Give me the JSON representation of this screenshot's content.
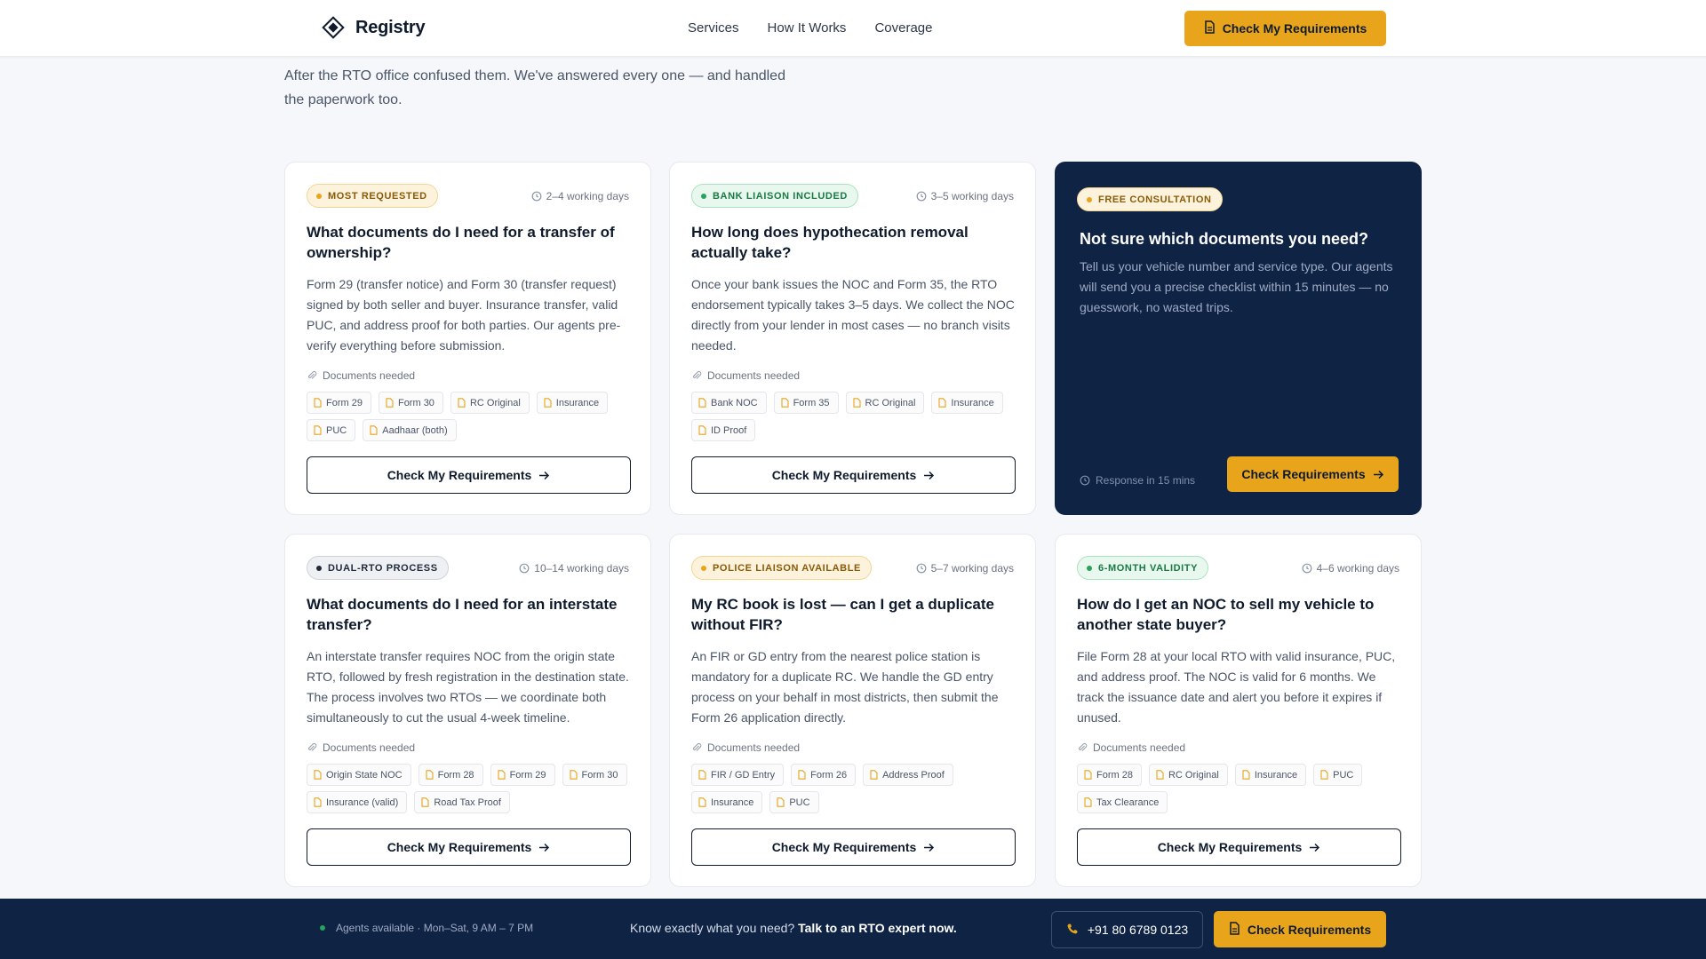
{
  "header": {
    "brand": "Registry",
    "nav": [
      "Services",
      "How It Works",
      "Coverage"
    ],
    "cta_label": "Check My Requirements"
  },
  "intro": {
    "text": "After the RTO office confused them. We've answered every one — and handled the paperwork too."
  },
  "cards": [
    {
      "badge": "MOST REQUESTED",
      "badge_style": "amber",
      "time": "2–4 working days",
      "title": "What documents do I need for a transfer of ownership?",
      "desc": "Form 29 (transfer notice) and Form 30 (transfer request) signed by both seller and buyer. Insurance transfer, valid PUC, and address proof for both parties. Our agents pre-verify everything before submission.",
      "docs_label": "Documents needed",
      "docs": [
        "Form 29",
        "Form 30",
        "RC Original",
        "Insurance",
        "PUC",
        "Aadhaar (both)"
      ],
      "cta": "Check My Requirements"
    },
    {
      "badge": "BANK LIAISON INCLUDED",
      "badge_style": "green",
      "time": "3–5 working days",
      "title": "How long does hypothecation removal actually take?",
      "desc": "Once your bank issues the NOC and Form 35, the RTO endorsement typically takes 3–5 days. We collect the NOC directly from your lender in most cases — no branch visits needed.",
      "docs_label": "Documents needed",
      "docs": [
        "Bank NOC",
        "Form 35",
        "RC Original",
        "Insurance",
        "ID Proof"
      ],
      "cta": "Check My Requirements"
    },
    {
      "badge": "DUAL-RTO PROCESS",
      "badge_style": "gray",
      "time": "10–14 working days",
      "title": "What documents do I need for an interstate transfer?",
      "desc": "An interstate transfer requires NOC from the origin state RTO, followed by fresh registration in the destination state. The process involves two RTOs — we coordinate both simultaneously to cut the usual 4-week timeline.",
      "docs_label": "Documents needed",
      "docs": [
        "Origin State NOC",
        "Form 28",
        "Form 29",
        "Form 30",
        "Insurance (valid)",
        "Road Tax Proof"
      ],
      "cta": "Check My Requirements"
    },
    {
      "badge": "POLICE LIAISON AVAILABLE",
      "badge_style": "amber",
      "time": "5–7 working days",
      "title": "My RC book is lost — can I get a duplicate without FIR?",
      "desc": "An FIR or GD entry from the nearest police station is mandatory for a duplicate RC. We handle the GD entry process on your behalf in most districts, then submit the Form 26 application directly.",
      "docs_label": "Documents needed",
      "docs": [
        "FIR / GD Entry",
        "Form 26",
        "Address Proof",
        "Insurance",
        "PUC"
      ],
      "cta": "Check My Requirements"
    },
    {
      "badge": "6-MONTH VALIDITY",
      "badge_style": "green",
      "time": "4–6 working days",
      "title": "How do I get an NOC to sell my vehicle to another state buyer?",
      "desc": "File Form 28 at your local RTO with valid insurance, PUC, and address proof. The NOC is valid for 6 months. We track the issuance date and alert you before it expires if unused.",
      "docs_label": "Documents needed",
      "docs": [
        "Form 28",
        "RC Original",
        "Insurance",
        "PUC",
        "Tax Clearance"
      ],
      "cta": "Check My Requirements"
    }
  ],
  "consult": {
    "badge": "FREE CONSULTATION",
    "title": "Not sure which documents you need?",
    "desc": "Tell us your vehicle number and service type. Our agents will send you a precise checklist within 15 minutes — no guesswork, no wasted trips.",
    "response": "Response in 15 mins",
    "cta": "Check Requirements"
  },
  "footer": {
    "availability": "Agents available · Mon–Sat, 9 AM – 7 PM",
    "message_lead": "Know exactly what you need?",
    "message_strong": "Talk to an RTO expert now.",
    "phone": "+91 80 6789 0123",
    "cta": "Check Requirements"
  },
  "colors": {
    "accent": "#e8a41b",
    "navy": "#0f2345",
    "green": "#27a35b"
  }
}
